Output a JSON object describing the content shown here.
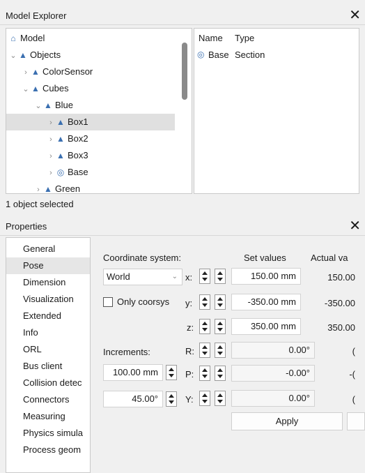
{
  "explorer": {
    "title": "Model Explorer",
    "close": "✕",
    "tree": [
      {
        "label": "Model",
        "chevron": "",
        "icon": "model-icon",
        "glyph": "⌂"
      },
      {
        "label": "Objects",
        "chevron": "⌄",
        "icon": "objects-icon",
        "glyph": "▲"
      },
      {
        "label": "ColorSensor",
        "chevron": "›",
        "icon": "object-icon",
        "glyph": "▲"
      },
      {
        "label": "Cubes",
        "chevron": "⌄",
        "icon": "object-icon",
        "glyph": "▲"
      },
      {
        "label": "Blue",
        "chevron": "⌄",
        "icon": "object-icon",
        "glyph": "▲"
      },
      {
        "label": "Box1",
        "chevron": "›",
        "icon": "object-icon",
        "glyph": "▲"
      },
      {
        "label": "Box2",
        "chevron": "›",
        "icon": "object-icon",
        "glyph": "▲"
      },
      {
        "label": "Box3",
        "chevron": "›",
        "icon": "object-icon",
        "glyph": "▲"
      },
      {
        "label": "Base",
        "chevron": "›",
        "icon": "section-icon",
        "glyph": "◎"
      },
      {
        "label": "Green",
        "chevron": "›",
        "icon": "object-icon",
        "glyph": "▲"
      }
    ],
    "detail": {
      "col_name": "Name",
      "col_type": "Type",
      "row_name": "Base",
      "row_type": "Section",
      "row_glyph": "◎"
    },
    "status": "1 object selected"
  },
  "properties": {
    "title": "Properties",
    "close": "✕",
    "tabs": [
      "General",
      "Pose",
      "Dimension",
      "Visualization",
      "Extended",
      "Info",
      "ORL",
      "Bus client",
      "Collision detec",
      "Connectors",
      "Measuring",
      "Physics simula",
      "Process geom"
    ],
    "active_tab": "Pose",
    "pose": {
      "coord_label": "Coordinate system:",
      "coord_value": "World",
      "only_coorsys": "Only coorsys",
      "increments_label": "Increments:",
      "inc_linear": "100.00 mm",
      "inc_angular": "45.00°",
      "set_values_label": "Set values",
      "actual_label": "Actual va",
      "axes": [
        "x:",
        "y:",
        "z:",
        "R:",
        "P:",
        "Y:"
      ],
      "set_values": [
        "150.00 mm",
        "-350.00 mm",
        "350.00 mm",
        "0.00°",
        "-0.00°",
        "0.00°"
      ],
      "actual_values": [
        "150.00",
        "-350.00",
        "350.00",
        "(",
        "-(",
        "("
      ],
      "apply": "Apply"
    }
  }
}
